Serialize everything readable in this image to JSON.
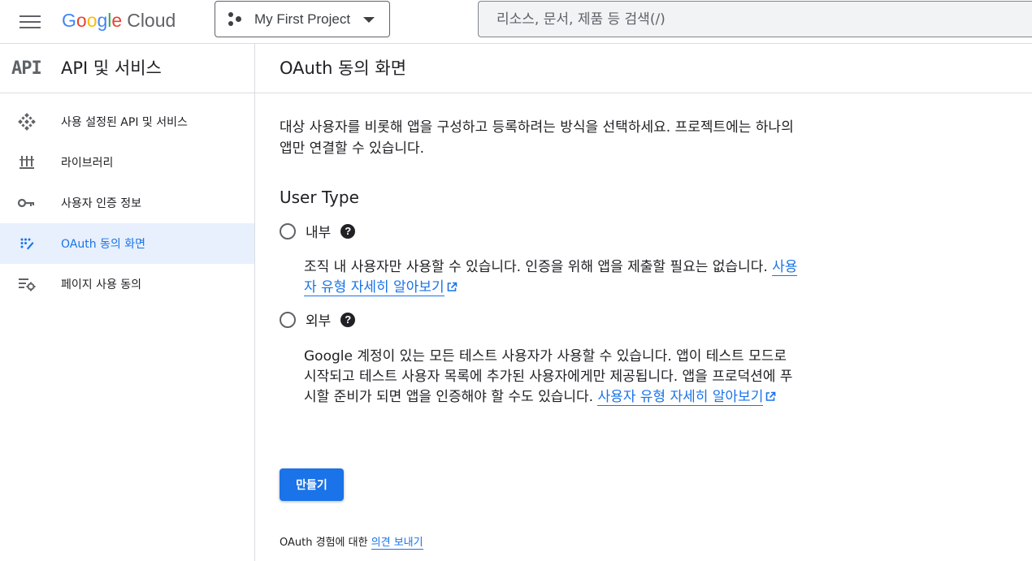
{
  "header": {
    "logo_parts": [
      "G",
      "o",
      "o",
      "g",
      "l",
      "e"
    ],
    "logo_cloud": "Cloud",
    "project_name": "My First Project",
    "search_placeholder": "리소스, 문서, 제품 등 검색(/)"
  },
  "sidebar": {
    "logo_text": "API",
    "title": "API 및 서비스",
    "items": [
      {
        "label": "사용 설정된 API 및 서비스",
        "icon": "diamond-grid-icon",
        "active": false
      },
      {
        "label": "라이브러리",
        "icon": "library-icon",
        "active": false
      },
      {
        "label": "사용자 인증 정보",
        "icon": "key-icon",
        "active": false
      },
      {
        "label": "OAuth 동의 화면",
        "icon": "oauth-icon",
        "active": true
      },
      {
        "label": "페이지 사용 동의",
        "icon": "settings-list-icon",
        "active": false
      }
    ]
  },
  "main": {
    "title": "OAuth 동의 화면",
    "intro": "대상 사용자를 비롯해 앱을 구성하고 등록하려는 방식을 선택하세요. 프로젝트에는 하나의 앱만 연결할 수 있습니다.",
    "user_type_title": "User Type",
    "options": [
      {
        "label": "내부",
        "desc": "조직 내 사용자만 사용할 수 있습니다. 인증을 위해 앱을 제출할 필요는 없습니다.",
        "link": "사용자 유형 자세히 알아보기"
      },
      {
        "label": "외부",
        "desc": "Google 계정이 있는 모든 테스트 사용자가 사용할 수 있습니다. 앱이 테스트 모드로 시작되고 테스트 사용자 목록에 추가된 사용자에게만 제공됩니다. 앱을 프로덕션에 푸시할 준비가 되면 앱을 인증해야 할 수도 있습니다.",
        "link": "사용자 유형 자세히 알아보기"
      }
    ],
    "help_glyph": "?",
    "create_button": "만들기",
    "feedback_prefix": "OAuth 경험에 대한 ",
    "feedback_link": "의견 보내기"
  },
  "colors": {
    "accent": "#1a73e8",
    "active_bg": "#e8f0fe",
    "divider": "#dadce0"
  }
}
